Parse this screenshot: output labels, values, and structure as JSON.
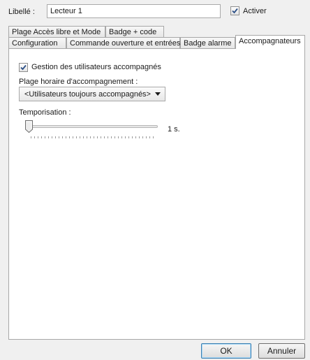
{
  "form": {
    "libelle_label": "Libellé :",
    "libelle_value": "Lecteur 1",
    "activer_label": "Activer",
    "activer_checked": true
  },
  "tabs": {
    "row_back": [
      {
        "label": "Plage Accès libre et Mode"
      },
      {
        "label": "Badge + code"
      }
    ],
    "row_front": [
      {
        "label": "Configuration"
      },
      {
        "label": "Commande ouverture et entrées"
      },
      {
        "label": "Badge alarme"
      },
      {
        "label": "Accompagnateurs"
      }
    ],
    "active": "Accompagnateurs"
  },
  "accompagnateurs": {
    "gestion_label": "Gestion des utilisateurs accompagnés",
    "gestion_checked": true,
    "plage_label": "Plage horaire d'accompagnement :",
    "plage_selected": "<Utilisateurs toujours accompagnés>",
    "tempo_label": "Temporisation :",
    "tempo_value": "1 s.",
    "tempo_slider_fraction": 0
  },
  "footer": {
    "ok_label": "OK",
    "cancel_label": "Annuler"
  },
  "icons": {
    "checkbox_check": "check-icon",
    "select_arrow": "chevron-down-icon",
    "slider_thumb": "slider-thumb-icon"
  },
  "colors": {
    "checkmark": "#2b4f86",
    "panel": "#ffffff",
    "window": "#f0f0f0"
  }
}
